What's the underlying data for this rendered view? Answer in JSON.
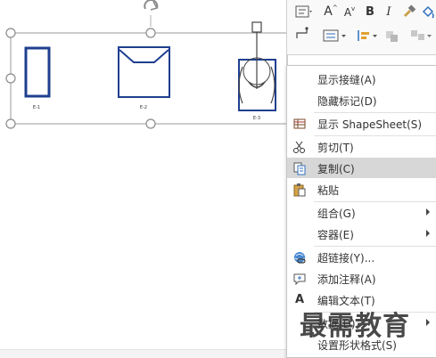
{
  "shapes": [
    {
      "label": "E-1"
    },
    {
      "label": "E-2"
    },
    {
      "label": "E-3"
    }
  ],
  "mini_toolbar": {
    "buttons": [
      {
        "name": "text-align-icon"
      },
      {
        "name": "increase-font-icon",
        "glyph": "A"
      },
      {
        "name": "decrease-font-icon",
        "glyph": "A"
      },
      {
        "name": "bold-button",
        "glyph": "B"
      },
      {
        "name": "italic-button",
        "glyph": "I"
      },
      {
        "name": "format-painter-icon"
      },
      {
        "name": "fill-icon"
      },
      {
        "name": "connector-icon"
      },
      {
        "name": "paragraph-icon"
      },
      {
        "name": "indent-icon"
      },
      {
        "name": "position-icon"
      },
      {
        "name": "group-icon"
      }
    ]
  },
  "context_menu": {
    "items": [
      {
        "id": "show-joins",
        "label": "显示接缝(A)",
        "icon": ""
      },
      {
        "id": "hide-markup",
        "label": "隐藏标记(D)",
        "icon": ""
      },
      {
        "id": "show-shapesheet",
        "label": "显示 ShapeSheet(S)",
        "icon": "shapesheet-icon"
      },
      {
        "id": "cut",
        "label": "剪切(T)",
        "icon": "scissors-icon"
      },
      {
        "id": "copy",
        "label": "复制(C)",
        "icon": "copy-icon"
      },
      {
        "id": "paste",
        "label": "粘贴",
        "icon": "paste-icon"
      },
      {
        "id": "group",
        "label": "组合(G)",
        "icon": "",
        "submenu": true
      },
      {
        "id": "container",
        "label": "容器(E)",
        "icon": "",
        "submenu": true
      },
      {
        "id": "hyperlink",
        "label": "超链接(Y)...",
        "icon": "hyperlink-icon"
      },
      {
        "id": "add-comment",
        "label": "添加注释(A)",
        "icon": "comment-icon"
      },
      {
        "id": "edit-text",
        "label": "编辑文本(T)",
        "icon": "text-edit-icon",
        "glyph": "A"
      },
      {
        "id": "data",
        "label": "数据(D)",
        "icon": "",
        "submenu": true
      },
      {
        "id": "format-shape",
        "label": "设置形状格式(S)",
        "icon": ""
      }
    ],
    "hovered": "copy"
  },
  "watermark": "最需教育"
}
